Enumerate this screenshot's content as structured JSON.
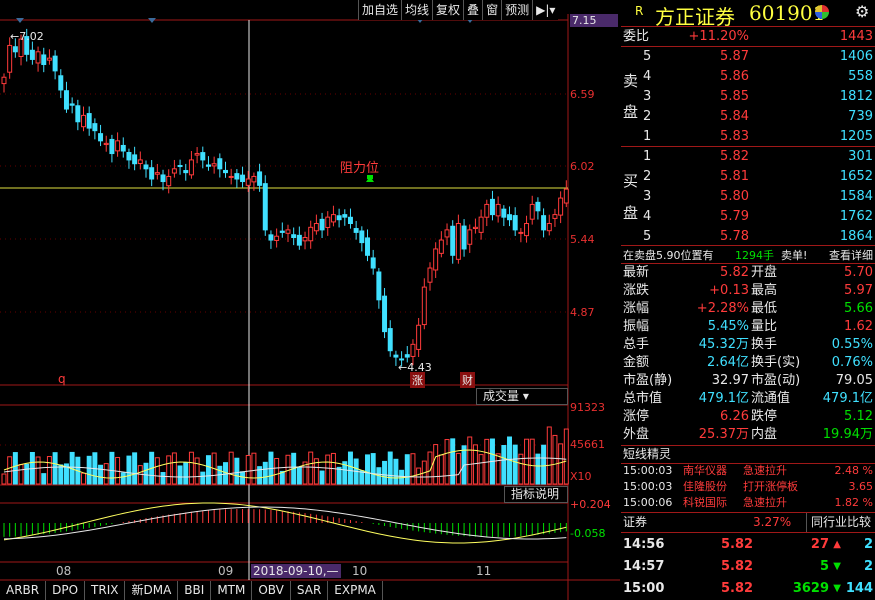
{
  "toolbar": {
    "items": [
      "加自选",
      "均线",
      "复权",
      "叠",
      "窗",
      "预测",
      "▶|▾"
    ]
  },
  "price_axis": [
    "7.15",
    "6.59",
    "6.02",
    "5.44",
    "4.87"
  ],
  "annotations": {
    "high": "←7.02",
    "low": "←4.43",
    "resistance": "阻力位",
    "q_mark": "q",
    "zhang": "涨",
    "cai": "财"
  },
  "volume": {
    "header": "成交量",
    "labels": [
      "91323",
      "45661",
      "X10"
    ]
  },
  "indicator": {
    "header": "指标说明",
    "labels": [
      "+0.204",
      "-0.058"
    ]
  },
  "x_axis": [
    "08",
    "09",
    "2018-09-10,—",
    "10",
    "11"
  ],
  "tabs": [
    "ARBR",
    "DPO",
    "TRIX",
    "新DMA",
    "BBI",
    "MTM",
    "OBV",
    "SAR",
    "EXPMA"
  ],
  "quote": {
    "r_mark": "R",
    "name": "方正证券",
    "code": "601901",
    "weibi": {
      "label": "委比",
      "pct": "+11.20%",
      "val": "1443"
    },
    "sell_side_label": [
      "卖",
      "盘"
    ],
    "buy_side_label": [
      "买",
      "盘"
    ],
    "sell": [
      {
        "lvl": "5",
        "p": "5.87",
        "v": "1406"
      },
      {
        "lvl": "4",
        "p": "5.86",
        "v": "558"
      },
      {
        "lvl": "3",
        "p": "5.85",
        "v": "1812"
      },
      {
        "lvl": "2",
        "p": "5.84",
        "v": "739"
      },
      {
        "lvl": "1",
        "p": "5.83",
        "v": "1205"
      }
    ],
    "buy": [
      {
        "lvl": "1",
        "p": "5.82",
        "v": "301"
      },
      {
        "lvl": "2",
        "p": "5.81",
        "v": "1652"
      },
      {
        "lvl": "3",
        "p": "5.80",
        "v": "1584"
      },
      {
        "lvl": "4",
        "p": "5.79",
        "v": "1762"
      },
      {
        "lvl": "5",
        "p": "5.78",
        "v": "1864"
      }
    ],
    "notice": {
      "text1": "在卖盘5.90位置有",
      "qty": "1294手",
      "text2": "卖单!",
      "link": "查看详细"
    },
    "stats": [
      {
        "l1": "最新",
        "v1": "5.82",
        "c1": "red",
        "l2": "开盘",
        "v2": "5.70",
        "c2": "red"
      },
      {
        "l1": "涨跌",
        "v1": "+0.13",
        "c1": "red",
        "l2": "最高",
        "v2": "5.97",
        "c2": "red"
      },
      {
        "l1": "涨幅",
        "v1": "+2.28%",
        "c1": "red",
        "l2": "最低",
        "v2": "5.66",
        "c2": "green"
      },
      {
        "l1": "振幅",
        "v1": "5.45%",
        "c1": "cyan",
        "l2": "量比",
        "v2": "1.62",
        "c2": "red"
      },
      {
        "l1": "总手",
        "v1": "45.32万",
        "c1": "cyan",
        "l2": "换手",
        "v2": "0.55%",
        "c2": "cyan"
      },
      {
        "l1": "金额",
        "v1": "2.64亿",
        "c1": "cyan",
        "l2": "换手(实)",
        "v2": "0.76%",
        "c2": "cyan"
      },
      {
        "l1": "市盈(静)",
        "v1": "32.97",
        "c1": "white",
        "l2": "市盈(动)",
        "v2": "79.05",
        "c2": "white"
      },
      {
        "l1": "总市值",
        "v1": "479.1亿",
        "c1": "cyan",
        "l2": "流通值",
        "v2": "479.1亿",
        "c2": "cyan"
      },
      {
        "l1": "涨停",
        "v1": "6.26",
        "c1": "red",
        "l2": "跌停",
        "v2": "5.12",
        "c2": "green"
      },
      {
        "l1": "外盘",
        "v1": "25.37万",
        "c1": "red",
        "l2": "内盘",
        "v2": "19.94万",
        "c2": "green"
      }
    ],
    "short_title": "短线精灵",
    "short": [
      {
        "t": "15:00:03",
        "n": "南华仪器",
        "e": "急速拉升",
        "v": "2.48 %"
      },
      {
        "t": "15:00:03",
        "n": "佳隆股份",
        "e": "打开涨停板",
        "v": "3.65"
      },
      {
        "t": "15:00:06",
        "n": "科锐国际",
        "e": "急速拉升",
        "v": "1.82 %"
      }
    ],
    "sector": {
      "name": "证券",
      "pct": "3.27%",
      "btn": "同行业比较"
    },
    "ticks": [
      {
        "t": "14:56",
        "p": "5.82",
        "v": "27",
        "dir": "up",
        "x": "2"
      },
      {
        "t": "14:57",
        "p": "5.82",
        "v": "5",
        "dir": "down",
        "x": "2"
      },
      {
        "t": "15:00",
        "p": "5.82",
        "v": "3629",
        "dir": "down",
        "x": "144"
      }
    ]
  }
}
